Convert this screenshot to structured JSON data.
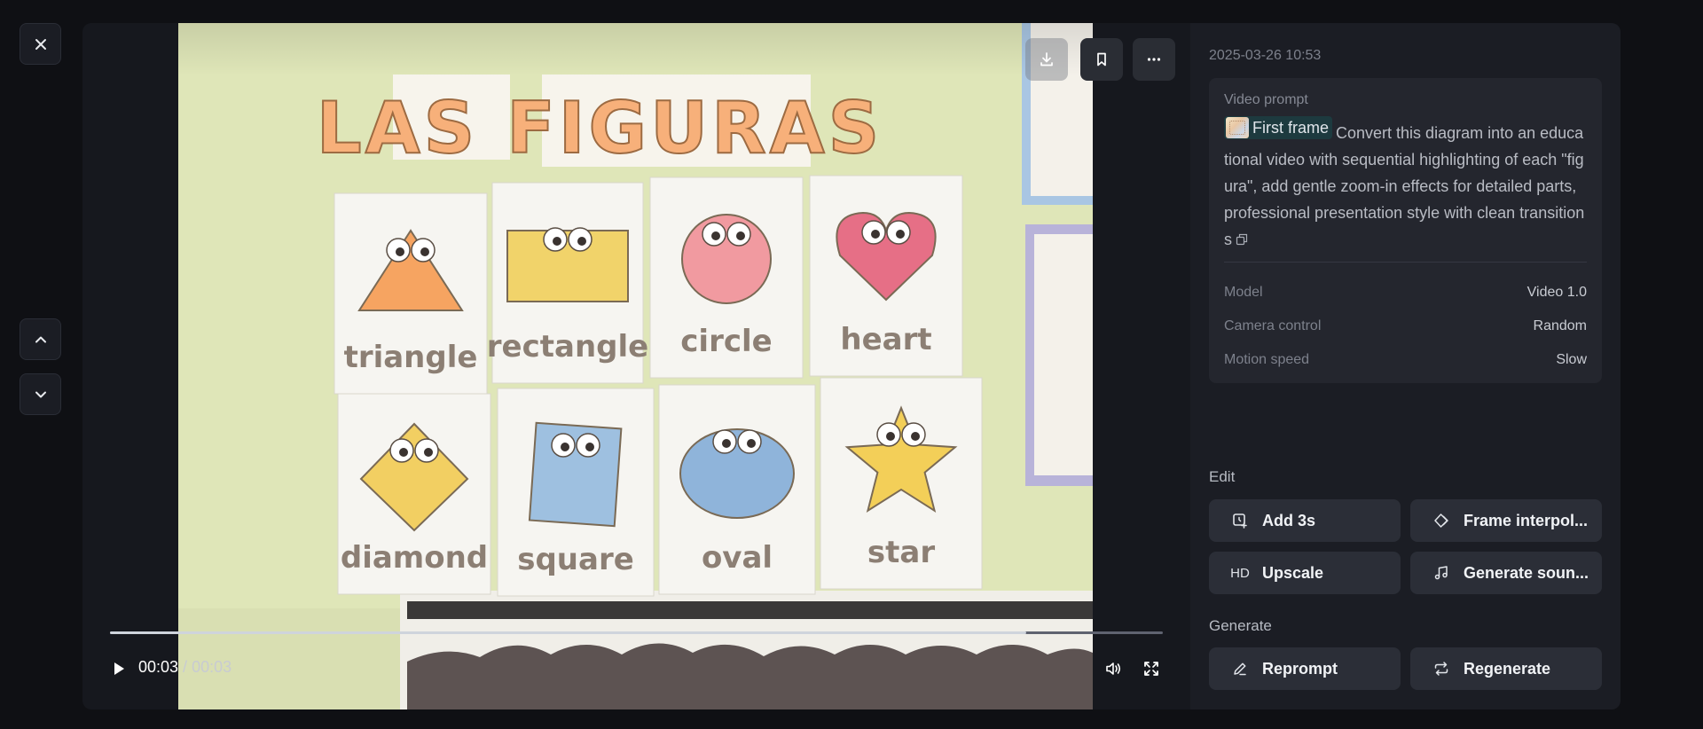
{
  "nav": {
    "close_icon": "close-icon",
    "prev_icon": "chevron-up-icon",
    "next_icon": "chevron-down-icon"
  },
  "player": {
    "current_time": "00:03",
    "separator": " / ",
    "total_time": "00:03",
    "progress": 0.87,
    "poster_title": "LAS FIGURAS",
    "shapes": [
      {
        "label": "triangle",
        "color": "#f6a461"
      },
      {
        "label": "rectangle",
        "color": "#f1d36a"
      },
      {
        "label": "circle",
        "color": "#f19aa0"
      },
      {
        "label": "heart",
        "color": "#e66f86"
      },
      {
        "label": "diamond",
        "color": "#f2cf62"
      },
      {
        "label": "square",
        "color": "#9ec0e0"
      },
      {
        "label": "oval",
        "color": "#8fb4da"
      },
      {
        "label": "star",
        "color": "#f3cf58"
      }
    ]
  },
  "details": {
    "timestamp": "2025-03-26 10:53",
    "prompt_label": "Video prompt",
    "reference_chip": "First frame",
    "prompt_text": "Convert this diagram into an educational video with sequential highlighting of each \"figura\", add gentle zoom-in effects for detailed parts, professional presentation style with clean transitions",
    "meta": [
      {
        "key": "Model",
        "value": "Video 1.0"
      },
      {
        "key": "Camera control",
        "value": "Random"
      },
      {
        "key": "Motion speed",
        "value": "Slow"
      }
    ]
  },
  "edit": {
    "title": "Edit",
    "add": "Add 3s",
    "interp": "Frame interpol...",
    "upscale_badge": "HD",
    "upscale": "Upscale",
    "sound": "Generate soun..."
  },
  "generate": {
    "title": "Generate",
    "reprompt": "Reprompt",
    "regenerate": "Regenerate"
  },
  "colors": {
    "background": "#0f1014",
    "panel": "#1b1d24",
    "chip": "#1d3a3f"
  }
}
